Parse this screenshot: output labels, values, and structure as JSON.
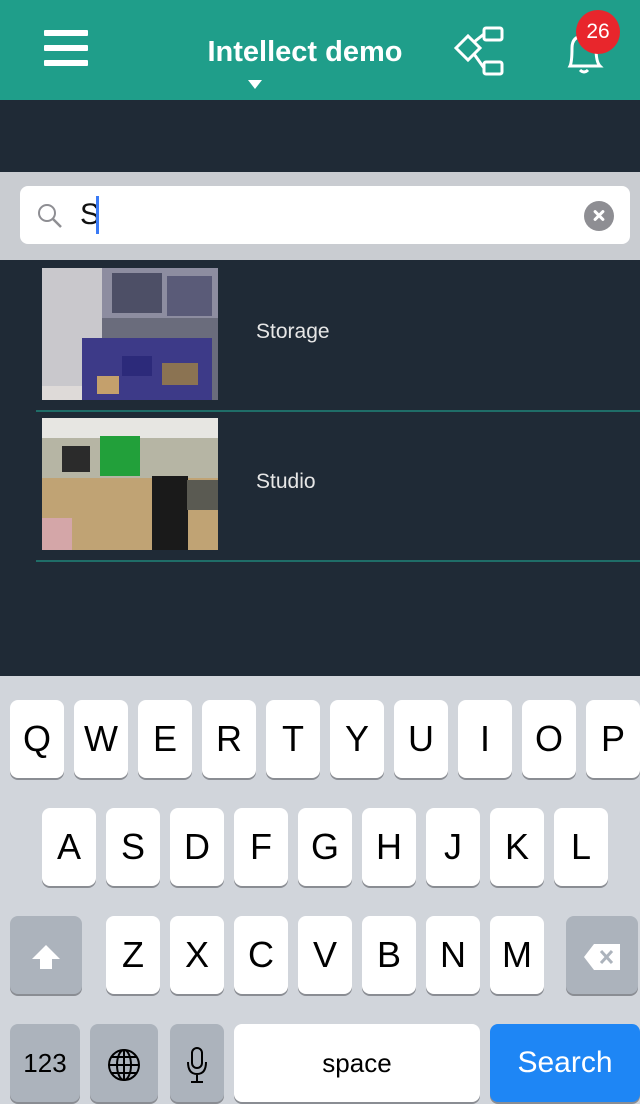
{
  "header": {
    "title": "Intellect demo",
    "notification_count": "26",
    "accent_color": "#1f9e8a",
    "icons": [
      "menu-icon",
      "tree-icon",
      "bell-icon"
    ]
  },
  "search": {
    "value": "S"
  },
  "cameras": [
    {
      "label": "Storage"
    },
    {
      "label": "Studio"
    }
  ],
  "keyboard": {
    "row1": [
      "Q",
      "W",
      "E",
      "R",
      "T",
      "Y",
      "U",
      "I",
      "O",
      "P"
    ],
    "row2": [
      "A",
      "S",
      "D",
      "F",
      "G",
      "H",
      "J",
      "K",
      "L"
    ],
    "row3": [
      "Z",
      "X",
      "C",
      "V",
      "B",
      "N",
      "M"
    ],
    "numbers_label": "123",
    "space_label": "space",
    "search_label": "Search"
  }
}
